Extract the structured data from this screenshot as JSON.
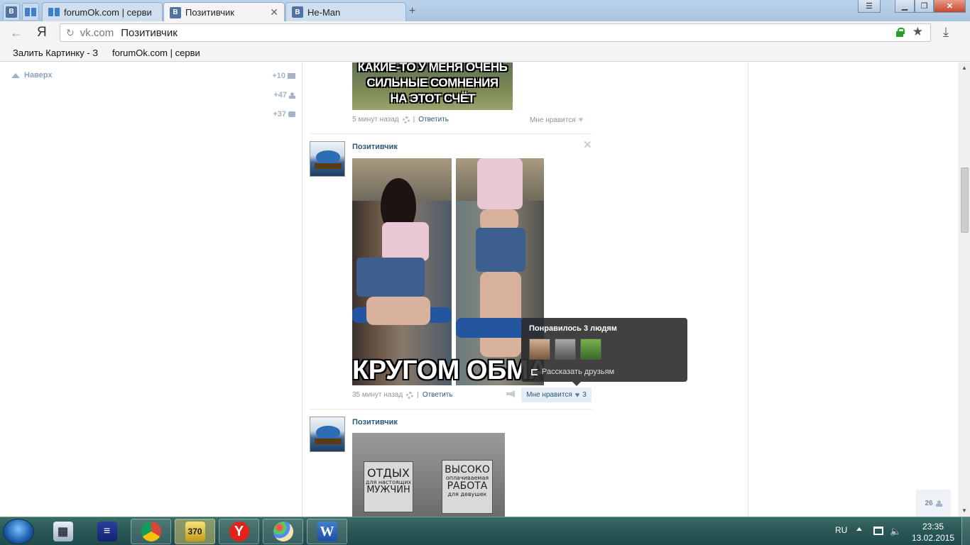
{
  "browser": {
    "tabs": [
      {
        "favicon": "vk-icon"
      },
      {
        "favicon": "book-icon"
      },
      {
        "label": "forumOk.com | серви",
        "favicon": "book-icon"
      },
      {
        "label": "Позитивчик",
        "favicon": "vk-icon",
        "active": true
      },
      {
        "label": "He-Man",
        "favicon": "vk-icon"
      }
    ],
    "new_tab_glyph": "+",
    "address": {
      "logo": "Я",
      "domain": "vk.com",
      "title": "Позитивчик"
    },
    "bookmarks": [
      "Залить Картинку - З",
      "forumOk.com | серви"
    ]
  },
  "left_nav": {
    "top_link": "Наверх",
    "counters": [
      {
        "value": "+10",
        "icon": "mail-icon"
      },
      {
        "value": "+47",
        "icon": "friends-icon"
      },
      {
        "value": "+37",
        "icon": "comment-icon"
      }
    ]
  },
  "posts": [
    {
      "meme_lines": [
        "КАКИЕ-ТО У МЕНЯ ОЧЕНЬ",
        "СИЛЬНЫЕ СОМНЕНИЯ",
        "НА ЭТОТ СЧЁТ"
      ],
      "time": "5 минут назад",
      "reply": "Ответить",
      "like": "Мне нравится",
      "like_count": ""
    },
    {
      "author": "Позитивчик",
      "meme_caption": "КРУГОМ ОБМАН",
      "time": "35 минут назад",
      "reply": "Ответить",
      "like": "Мне нравится",
      "like_count": "3"
    },
    {
      "author": "Позитивчик",
      "sign_left": [
        "ОТДЫХ",
        "для настоящих",
        "МУЖЧИН"
      ],
      "sign_right": [
        "ВЫСОКО",
        "оплачиваемая",
        "РАБОТА",
        "для девушек"
      ]
    }
  ],
  "like_popup": {
    "title": "Понравилось 3 людям",
    "share": "Рассказать друзьям"
  },
  "online_count": "26",
  "taskbar": {
    "apps": [
      "calculator-icon",
      "notes-icon",
      "chrome-icon",
      "media-icon",
      "yandex-icon",
      "paint-icon",
      "word-icon"
    ],
    "lang": "RU",
    "time": "23:35",
    "date": "13.02.2015"
  },
  "colors": {
    "vk_link": "#2b587a",
    "vk_blue": "#4f74a2",
    "muted": "#8a94a0"
  }
}
